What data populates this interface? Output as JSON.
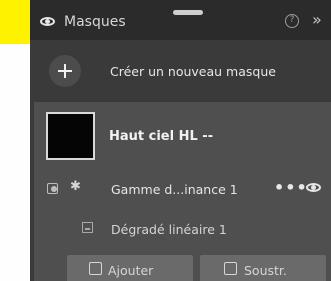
{
  "panel": {
    "title": "Masques",
    "help": "?",
    "expand": "»"
  },
  "create": {
    "label": "Créer un nouveau masque"
  },
  "mask": {
    "name": "Haut ciel HL --",
    "components": [
      {
        "label": "Gamme d...inance 1",
        "more": "•••"
      },
      {
        "label": "Dégradé linéaire 1"
      }
    ]
  },
  "actions": {
    "add_label": "Ajouter",
    "subtract_label": "Soustr."
  },
  "colors": {
    "highlight": "#fff200",
    "panel_bg": "#3a3a3a",
    "header_bg": "#2b2b2b",
    "mask_bg": "#4f4f4f",
    "button_bg": "#6a6a6a"
  }
}
